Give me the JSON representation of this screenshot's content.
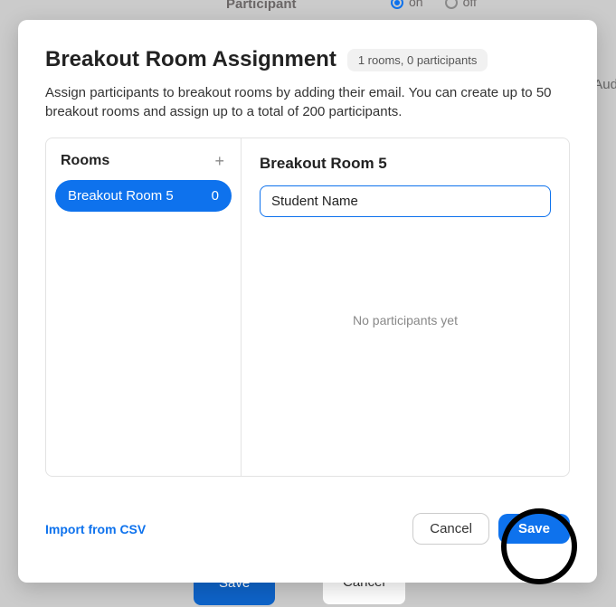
{
  "background": {
    "participant_label": "Participant",
    "radio_on": "on",
    "radio_off": "off",
    "aud_fragment": "Aud",
    "save_label": "Save",
    "cancel_label": "Cancel"
  },
  "modal": {
    "title": "Breakout Room Assignment",
    "badge": "1 rooms, 0 participants",
    "description": "Assign participants to breakout rooms by adding their email. You can create up to 50 breakout rooms and assign up to a total of 200 participants.",
    "rooms_header": "Rooms",
    "rooms": [
      {
        "label": "Breakout Room 5",
        "count": "0"
      }
    ],
    "selected_room_title": "Breakout Room 5",
    "name_input_value": "Student Name",
    "empty_state": "No participants yet",
    "import_label": "Import from CSV",
    "cancel_label": "Cancel",
    "save_label": "Save"
  }
}
